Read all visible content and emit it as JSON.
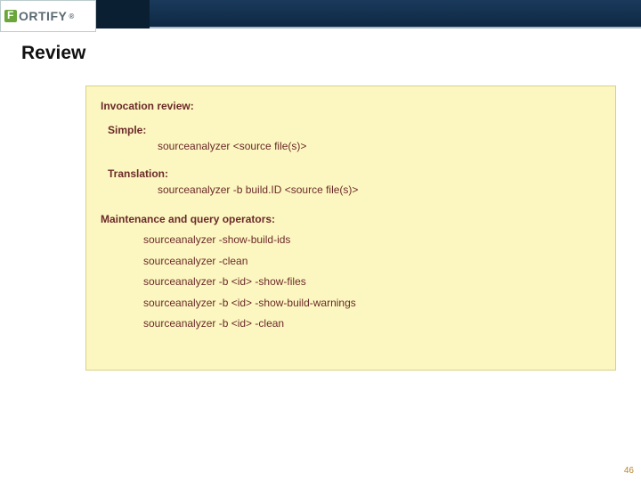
{
  "logo": {
    "text": "ORTIFY",
    "reg": "®"
  },
  "title": "Review",
  "box": {
    "invocation_heading": "Invocation review:",
    "simple_label": "Simple:",
    "simple_cmd": "sourceanalyzer <source file(s)>",
    "translation_label": "Translation:",
    "translation_cmd": "sourceanalyzer -b build.ID <source file(s)>",
    "maintenance_heading": "Maintenance and query operators:",
    "maint": [
      "sourceanalyzer  -show-build-ids",
      "sourceanalyzer  -clean",
      "sourceanalyzer  -b <id> -show-files",
      "sourceanalyzer  -b <id> -show-build-warnings",
      "sourceanalyzer  -b <id> -clean"
    ]
  },
  "page_number": "46"
}
